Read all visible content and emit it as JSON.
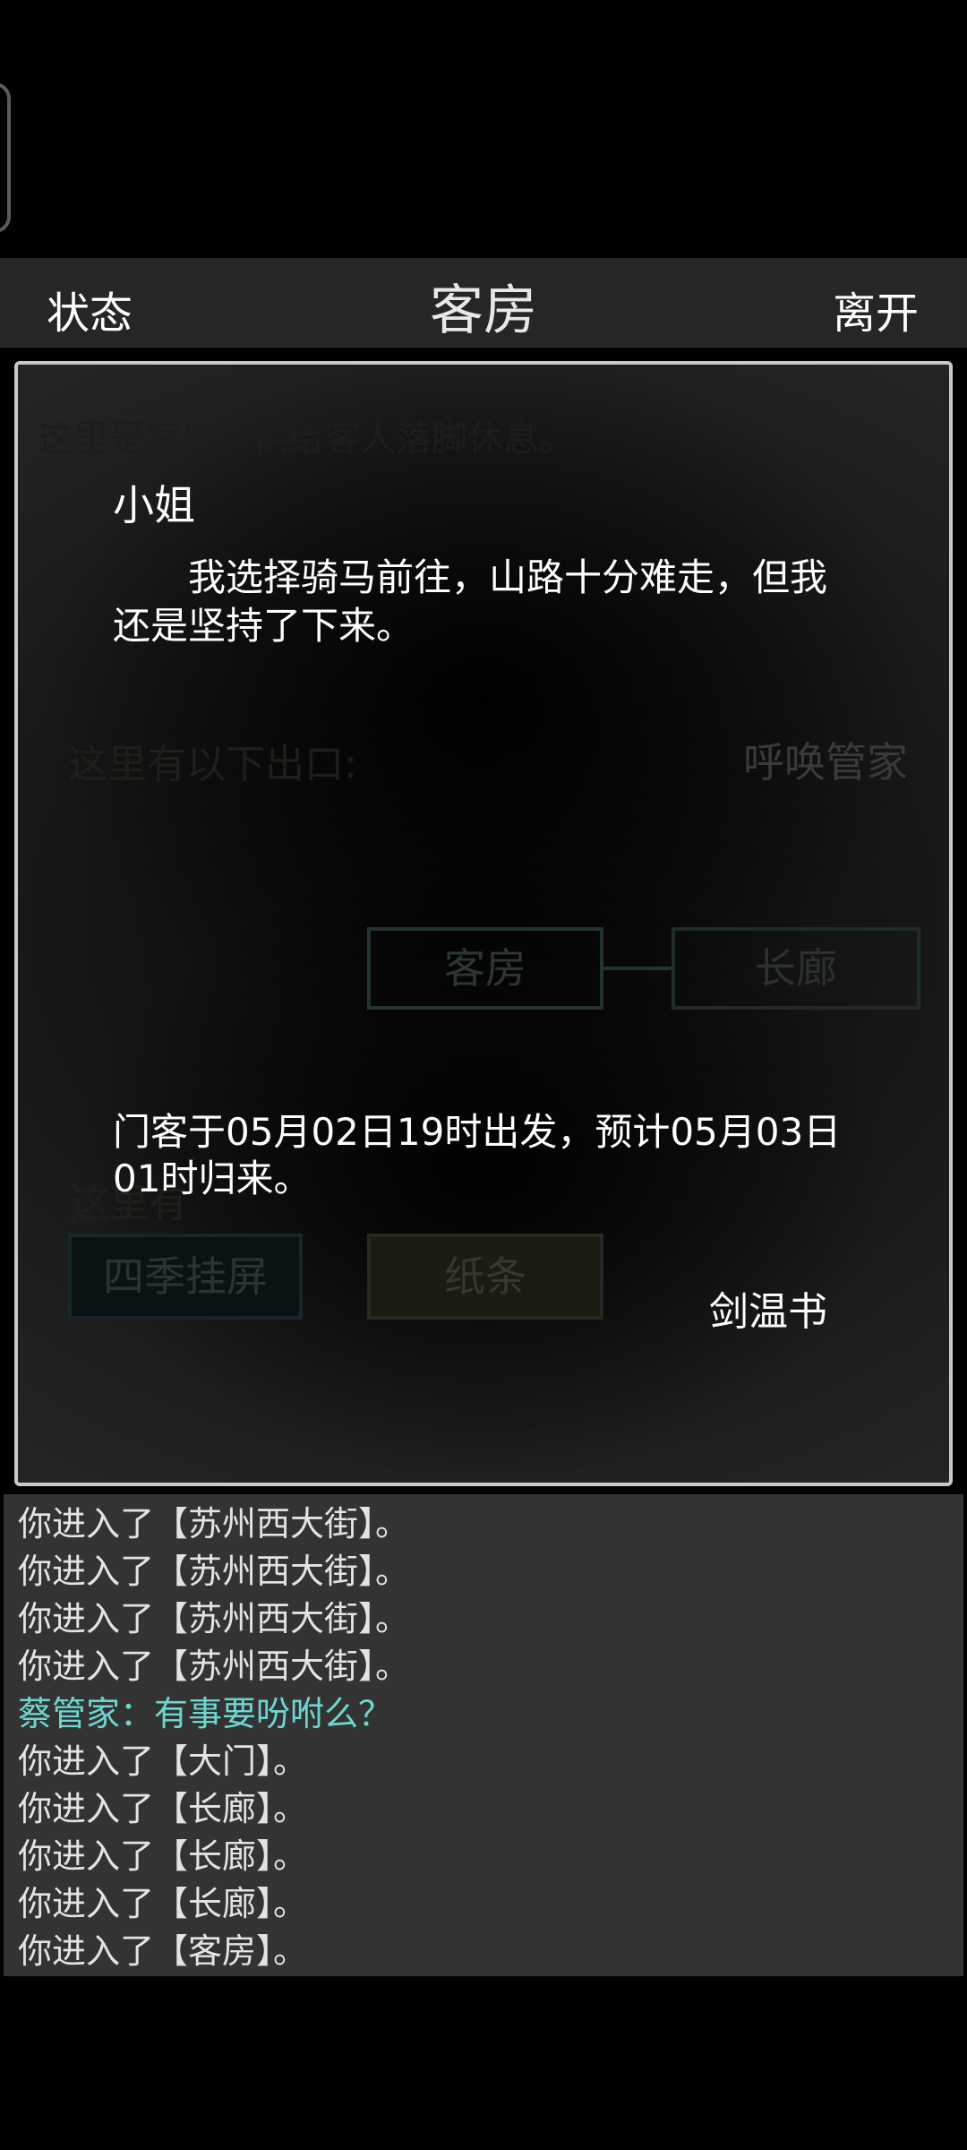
{
  "header": {
    "left_button": "状态",
    "title": "客房",
    "right_button": "离开"
  },
  "room": {
    "description": "这里是客房，供给客人落脚休息。",
    "exits_label": "这里有以下出口:",
    "call_steward": "呼唤管家",
    "map": {
      "current": "客房",
      "neighbor": "长廊"
    },
    "here_label": "这里有",
    "items": [
      "四季挂屏",
      "纸条"
    ]
  },
  "dialog": {
    "speaker": "小姐",
    "text": "我选择骑马前往，山路十分难走，但我还是坚持了下来。",
    "notice": "门客于05月02日19时出发，预计05月03日01时归来。",
    "author": "剑温书"
  },
  "log": {
    "lines": [
      {
        "text": "你进入了【苏州西大街】。",
        "type": "system"
      },
      {
        "text": "你进入了【苏州西大街】。",
        "type": "system"
      },
      {
        "text": "你进入了【苏州西大街】。",
        "type": "system"
      },
      {
        "text": "你进入了【苏州西大街】。",
        "type": "system"
      },
      {
        "text": "蔡管家：有事要吩咐么？",
        "type": "npc"
      },
      {
        "text": "你进入了【大门】。",
        "type": "system"
      },
      {
        "text": "你进入了【长廊】。",
        "type": "system"
      },
      {
        "text": "你进入了【长廊】。",
        "type": "system"
      },
      {
        "text": "你进入了【长廊】。",
        "type": "system"
      },
      {
        "text": "你进入了【客房】。",
        "type": "system"
      }
    ]
  },
  "colors": {
    "background": "#000000",
    "header": "#262626",
    "log_background": "#333333",
    "npc_text": "#6cd6d0",
    "panel_border": "#c9c9c9"
  }
}
